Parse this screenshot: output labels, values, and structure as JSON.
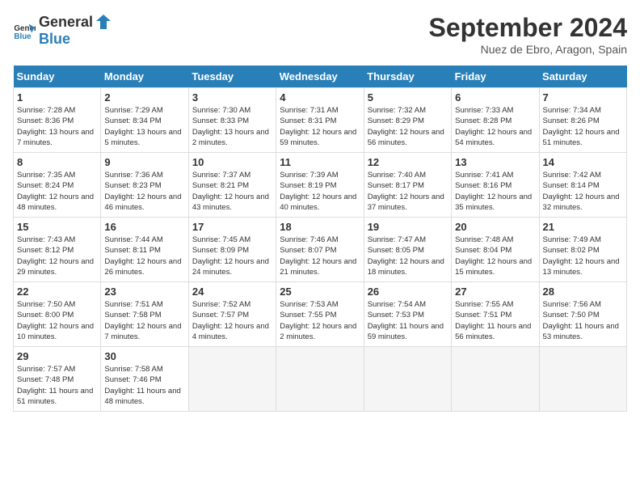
{
  "logo": {
    "general": "General",
    "blue": "Blue"
  },
  "title": "September 2024",
  "subtitle": "Nuez de Ebro, Aragon, Spain",
  "days_header": [
    "Sunday",
    "Monday",
    "Tuesday",
    "Wednesday",
    "Thursday",
    "Friday",
    "Saturday"
  ],
  "weeks": [
    [
      {
        "day": "1",
        "info": "Sunrise: 7:28 AM\nSunset: 8:36 PM\nDaylight: 13 hours and 7 minutes."
      },
      {
        "day": "2",
        "info": "Sunrise: 7:29 AM\nSunset: 8:34 PM\nDaylight: 13 hours and 5 minutes."
      },
      {
        "day": "3",
        "info": "Sunrise: 7:30 AM\nSunset: 8:33 PM\nDaylight: 13 hours and 2 minutes."
      },
      {
        "day": "4",
        "info": "Sunrise: 7:31 AM\nSunset: 8:31 PM\nDaylight: 12 hours and 59 minutes."
      },
      {
        "day": "5",
        "info": "Sunrise: 7:32 AM\nSunset: 8:29 PM\nDaylight: 12 hours and 56 minutes."
      },
      {
        "day": "6",
        "info": "Sunrise: 7:33 AM\nSunset: 8:28 PM\nDaylight: 12 hours and 54 minutes."
      },
      {
        "day": "7",
        "info": "Sunrise: 7:34 AM\nSunset: 8:26 PM\nDaylight: 12 hours and 51 minutes."
      }
    ],
    [
      {
        "day": "8",
        "info": "Sunrise: 7:35 AM\nSunset: 8:24 PM\nDaylight: 12 hours and 48 minutes."
      },
      {
        "day": "9",
        "info": "Sunrise: 7:36 AM\nSunset: 8:23 PM\nDaylight: 12 hours and 46 minutes."
      },
      {
        "day": "10",
        "info": "Sunrise: 7:37 AM\nSunset: 8:21 PM\nDaylight: 12 hours and 43 minutes."
      },
      {
        "day": "11",
        "info": "Sunrise: 7:39 AM\nSunset: 8:19 PM\nDaylight: 12 hours and 40 minutes."
      },
      {
        "day": "12",
        "info": "Sunrise: 7:40 AM\nSunset: 8:17 PM\nDaylight: 12 hours and 37 minutes."
      },
      {
        "day": "13",
        "info": "Sunrise: 7:41 AM\nSunset: 8:16 PM\nDaylight: 12 hours and 35 minutes."
      },
      {
        "day": "14",
        "info": "Sunrise: 7:42 AM\nSunset: 8:14 PM\nDaylight: 12 hours and 32 minutes."
      }
    ],
    [
      {
        "day": "15",
        "info": "Sunrise: 7:43 AM\nSunset: 8:12 PM\nDaylight: 12 hours and 29 minutes."
      },
      {
        "day": "16",
        "info": "Sunrise: 7:44 AM\nSunset: 8:11 PM\nDaylight: 12 hours and 26 minutes."
      },
      {
        "day": "17",
        "info": "Sunrise: 7:45 AM\nSunset: 8:09 PM\nDaylight: 12 hours and 24 minutes."
      },
      {
        "day": "18",
        "info": "Sunrise: 7:46 AM\nSunset: 8:07 PM\nDaylight: 12 hours and 21 minutes."
      },
      {
        "day": "19",
        "info": "Sunrise: 7:47 AM\nSunset: 8:05 PM\nDaylight: 12 hours and 18 minutes."
      },
      {
        "day": "20",
        "info": "Sunrise: 7:48 AM\nSunset: 8:04 PM\nDaylight: 12 hours and 15 minutes."
      },
      {
        "day": "21",
        "info": "Sunrise: 7:49 AM\nSunset: 8:02 PM\nDaylight: 12 hours and 13 minutes."
      }
    ],
    [
      {
        "day": "22",
        "info": "Sunrise: 7:50 AM\nSunset: 8:00 PM\nDaylight: 12 hours and 10 minutes."
      },
      {
        "day": "23",
        "info": "Sunrise: 7:51 AM\nSunset: 7:58 PM\nDaylight: 12 hours and 7 minutes."
      },
      {
        "day": "24",
        "info": "Sunrise: 7:52 AM\nSunset: 7:57 PM\nDaylight: 12 hours and 4 minutes."
      },
      {
        "day": "25",
        "info": "Sunrise: 7:53 AM\nSunset: 7:55 PM\nDaylight: 12 hours and 2 minutes."
      },
      {
        "day": "26",
        "info": "Sunrise: 7:54 AM\nSunset: 7:53 PM\nDaylight: 11 hours and 59 minutes."
      },
      {
        "day": "27",
        "info": "Sunrise: 7:55 AM\nSunset: 7:51 PM\nDaylight: 11 hours and 56 minutes."
      },
      {
        "day": "28",
        "info": "Sunrise: 7:56 AM\nSunset: 7:50 PM\nDaylight: 11 hours and 53 minutes."
      }
    ],
    [
      {
        "day": "29",
        "info": "Sunrise: 7:57 AM\nSunset: 7:48 PM\nDaylight: 11 hours and 51 minutes."
      },
      {
        "day": "30",
        "info": "Sunrise: 7:58 AM\nSunset: 7:46 PM\nDaylight: 11 hours and 48 minutes."
      },
      null,
      null,
      null,
      null,
      null
    ]
  ]
}
